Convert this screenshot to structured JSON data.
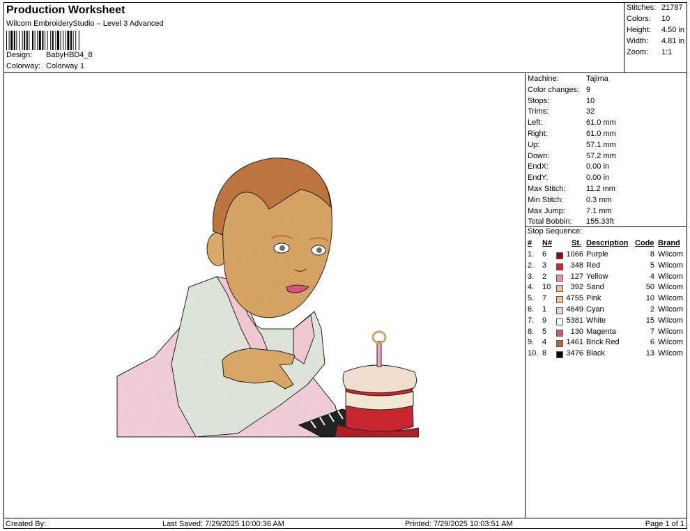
{
  "header": {
    "title": "Production Worksheet",
    "subtitle": "Wilcom EmbroideryStudio – Level 3 Advanced",
    "design_label": "Design:",
    "design_value": "BabyHBD4_8",
    "colorway_label": "Colorway:",
    "colorway_value": "Colorway 1"
  },
  "stats": [
    {
      "label": "Stitches:",
      "value": "21787"
    },
    {
      "label": "Colors:",
      "value": "10"
    },
    {
      "label": "Height:",
      "value": "4.50 in"
    },
    {
      "label": "Width:",
      "value": "4.81 in"
    },
    {
      "label": "Zoom:",
      "value": "1:1"
    }
  ],
  "machine_info": [
    {
      "label": "Machine:",
      "value": "Tajima"
    },
    {
      "label": "Color changes:",
      "value": "9"
    },
    {
      "label": "Stops:",
      "value": "10"
    },
    {
      "label": "Trims:",
      "value": "32"
    },
    {
      "label": "Left:",
      "value": "61.0 mm"
    },
    {
      "label": "Right:",
      "value": "61.0 mm"
    },
    {
      "label": "Up:",
      "value": "57.1 mm"
    },
    {
      "label": "Down:",
      "value": "57.2 mm"
    },
    {
      "label": "EndX:",
      "value": "0.00 in"
    },
    {
      "label": "EndY:",
      "value": "0.00 in"
    },
    {
      "label": "Max Stitch:",
      "value": "11.2 mm"
    },
    {
      "label": "Min Stitch:",
      "value": "0.3 mm"
    },
    {
      "label": "Max Jump:",
      "value": "7.1 mm"
    },
    {
      "label": "Total Bobbin:",
      "value": "155.33ft"
    }
  ],
  "stop_sequence": {
    "title": "Stop Sequence:",
    "headers": {
      "num": "#",
      "n": "N#",
      "st": "St.",
      "desc": "Description",
      "code": "Code",
      "brand": "Brand"
    },
    "rows": [
      {
        "num": "1.",
        "n": "6",
        "color": "#8b0d12",
        "st": "1066",
        "desc": "Purple",
        "code": "8",
        "brand": "Wilcom"
      },
      {
        "num": "2.",
        "n": "3",
        "color": "#d8202e",
        "st": "348",
        "desc": "Red",
        "code": "5",
        "brand": "Wilcom"
      },
      {
        "num": "3.",
        "n": "2",
        "color": "#ee8fae",
        "st": "127",
        "desc": "Yellow",
        "code": "4",
        "brand": "Wilcom"
      },
      {
        "num": "4.",
        "n": "10",
        "color": "#efc89a",
        "st": "392",
        "desc": "Sand",
        "code": "50",
        "brand": "Wilcom"
      },
      {
        "num": "5.",
        "n": "7",
        "color": "#f1c5a0",
        "st": "4755",
        "desc": "Pink",
        "code": "10",
        "brand": "Wilcom"
      },
      {
        "num": "6.",
        "n": "1",
        "color": "#f6c9d5",
        "st": "4649",
        "desc": "Cyan",
        "code": "2",
        "brand": "Wilcom"
      },
      {
        "num": "7.",
        "n": "9",
        "color": "#ffffff",
        "st": "5381",
        "desc": "White",
        "code": "15",
        "brand": "Wilcom"
      },
      {
        "num": "8.",
        "n": "5",
        "color": "#d0596f",
        "st": "130",
        "desc": "Magenta",
        "code": "7",
        "brand": "Wilcom"
      },
      {
        "num": "9.",
        "n": "4",
        "color": "#b06a3d",
        "st": "1461",
        "desc": "Brick Red",
        "code": "6",
        "brand": "Wilcom"
      },
      {
        "num": "10.",
        "n": "8",
        "color": "#000000",
        "st": "3476",
        "desc": "Black",
        "code": "13",
        "brand": "Wilcom"
      }
    ]
  },
  "footer": {
    "created_by": "Created By:",
    "last_saved": "Last Saved: 7/29/2025 10:00:36 AM",
    "printed": "Printed: 7/29/2025 10:03:51 AM",
    "page": "Page 1 of 1"
  }
}
